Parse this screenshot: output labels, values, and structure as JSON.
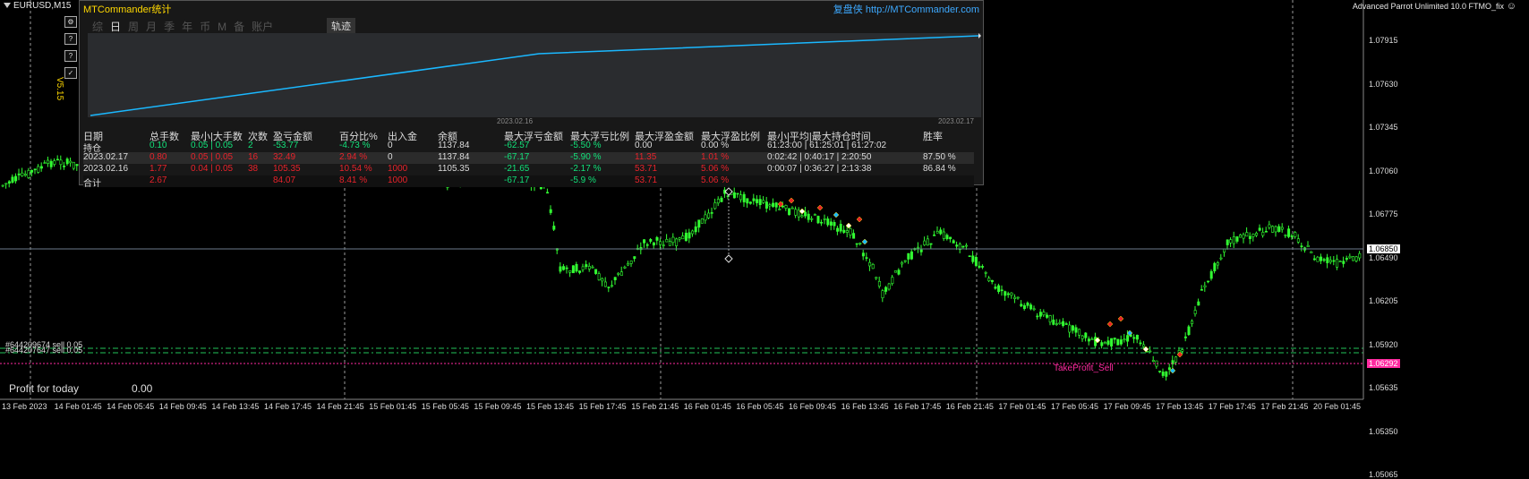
{
  "chart_header": {
    "symbol": "EURUSD,M15",
    "expert_label": "Advanced Parrot Unlimited 10.0 FTMO_fix"
  },
  "stats_panel": {
    "title": "MTCommander统计",
    "link": "复盘侠 http://MTCommander.com",
    "period_tabs": [
      "综",
      "日",
      "周",
      "月",
      "季",
      "年",
      "币",
      "M",
      "备",
      "账户"
    ],
    "active_tab": "日",
    "trajectory_tab": "轨迹",
    "version": "V5.15",
    "equity_dates": [
      "2023.02.16",
      "2023.02.17"
    ],
    "table": {
      "headers": [
        "日期",
        "总手数",
        "最小|大手数",
        "次数",
        "盈亏金额",
        "百分比%",
        "出入金",
        "余额",
        "最大浮亏金额",
        "最大浮亏比例",
        "最大浮盈金额",
        "最大浮盈比例",
        "最小|平均|最大持仓时间",
        "胜率"
      ],
      "rows": [
        {
          "cells": [
            "持仓",
            "0.10",
            "0.05 | 0.05",
            "2",
            "-53.77",
            "-4.73 %",
            "0",
            "1137.84",
            "-62.57",
            "-5.50 %",
            "0.00",
            "0.00 %",
            "61:23:00 | 61:25:01 | 61:27:02",
            ""
          ],
          "colors": [
            "w",
            "g",
            "g",
            "g",
            "g",
            "g",
            "w",
            "w",
            "g",
            "g",
            "w",
            "w",
            "w",
            "w"
          ]
        },
        {
          "cells": [
            "2023.02.17",
            "0.80",
            "0.05 | 0.05",
            "16",
            "32.49",
            "2.94 %",
            "0",
            "1137.84",
            "-67.17",
            "-5.90 %",
            "11.35",
            "1.01 %",
            "0:02:42 | 0:40:17 | 2:20:50",
            "87.50 %"
          ],
          "colors": [
            "w",
            "r",
            "r",
            "r",
            "r",
            "r",
            "w",
            "w",
            "g",
            "g",
            "r",
            "r",
            "w",
            "w"
          ]
        },
        {
          "cells": [
            "2023.02.16",
            "1.77",
            "0.04 | 0.05",
            "38",
            "105.35",
            "10.54 %",
            "1000",
            "1105.35",
            "-21.65",
            "-2.17 %",
            "53.71",
            "5.06 %",
            "0:00:07 | 0:36:27 | 2:13:38",
            "86.84 %"
          ],
          "colors": [
            "w",
            "r",
            "r",
            "r",
            "r",
            "r",
            "r",
            "w",
            "g",
            "g",
            "r",
            "r",
            "w",
            "w"
          ]
        },
        {
          "cells": [
            "合计",
            "2.67",
            "",
            "",
            "84.07",
            "8.41 %",
            "1000",
            "",
            "-67.17",
            "-5.9 %",
            "53.71",
            "5.06 %",
            "",
            ""
          ],
          "colors": [
            "w",
            "r",
            "w",
            "w",
            "r",
            "r",
            "r",
            "w",
            "g",
            "g",
            "r",
            "r",
            "w",
            "w"
          ]
        }
      ]
    }
  },
  "price_axis": {
    "labels": [
      "1.07915",
      "1.07630",
      "1.07345",
      "1.07060",
      "1.06775",
      "1.06490",
      "1.06205",
      "1.05920",
      "1.05635",
      "1.05350",
      "1.05065"
    ],
    "current_price": "1.06850",
    "tp_price": "1.06292"
  },
  "time_axis": [
    "13 Feb 2023",
    "14 Feb 01:45",
    "14 Feb 05:45",
    "14 Feb 09:45",
    "14 Feb 13:45",
    "14 Feb 17:45",
    "14 Feb 21:45",
    "15 Feb 01:45",
    "15 Feb 05:45",
    "15 Feb 09:45",
    "15 Feb 13:45",
    "15 Feb 17:45",
    "15 Feb 21:45",
    "16 Feb 01:45",
    "16 Feb 05:45",
    "16 Feb 09:45",
    "16 Feb 13:45",
    "16 Feb 17:45",
    "16 Feb 21:45",
    "17 Feb 01:45",
    "17 Feb 05:45",
    "17 Feb 09:45",
    "17 Feb 13:45",
    "17 Feb 17:45",
    "17 Feb 21:45",
    "20 Feb 01:45"
  ],
  "orders": [
    {
      "label": "#644209674 sell 0.05"
    },
    {
      "label": "#644207647 sell 0.05"
    }
  ],
  "take_profit_label": "TakeProfit_Sell",
  "profit_today": {
    "label": "Profit for today",
    "value": "0.00"
  },
  "colors": {
    "candle": "#32ff32",
    "equity": "#1ab8ff",
    "tp_line": "#ff2aa0",
    "order_line": "#22c35a",
    "price_line": "#6b7a8c"
  }
}
